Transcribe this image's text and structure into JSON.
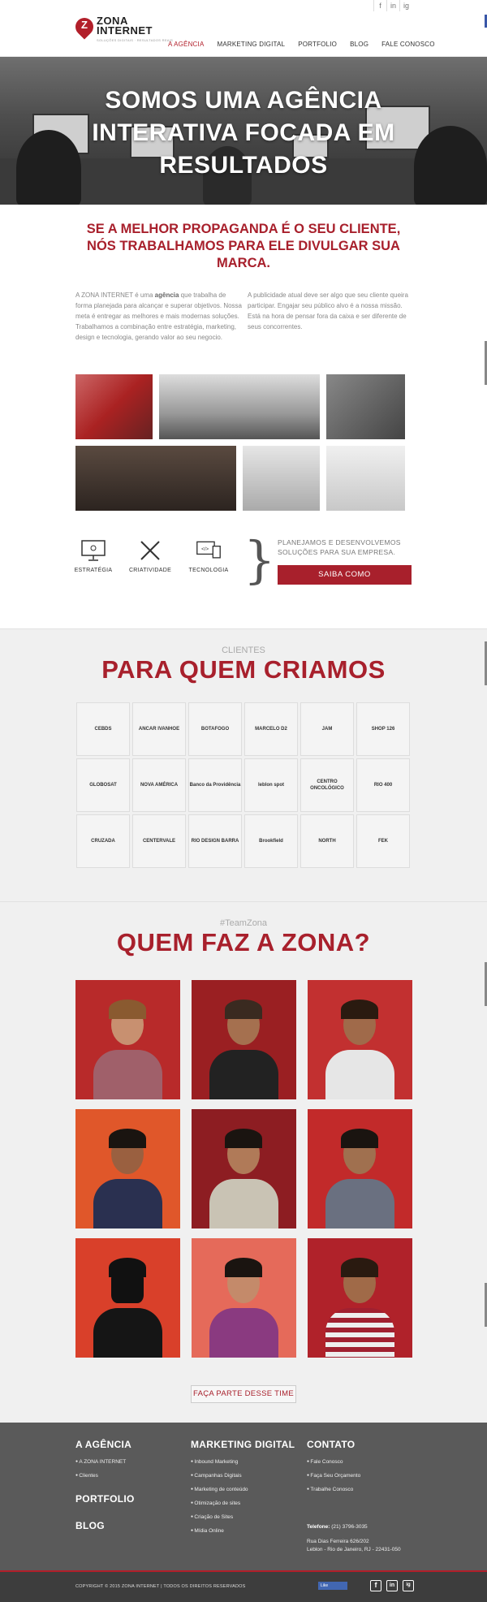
{
  "topbar": {
    "social": [
      "f",
      "in",
      "ig"
    ]
  },
  "header": {
    "logo_title": "ZONA INTERNET",
    "logo_tagline": "SOLUÇÕES DIGITAIS · RESULTADOS REAIS",
    "nav": [
      {
        "label": "A AGÊNCIA",
        "active": true
      },
      {
        "label": "MARKETING DIGITAL",
        "active": false
      },
      {
        "label": "PORTFOLIO",
        "active": false
      },
      {
        "label": "BLOG",
        "active": false
      },
      {
        "label": "FALE CONOSCO",
        "active": false
      }
    ]
  },
  "hero": {
    "line1": "SOMOS UMA AGÊNCIA",
    "line2": "INTERATIVA FOCADA EM",
    "line3": "RESULTADOS"
  },
  "intro": {
    "head1": "SE A MELHOR PROPAGANDA É O SEU CLIENTE,",
    "head2": "NÓS TRABALHAMOS PARA ELE DIVULGAR SUA",
    "head3": "MARCA.",
    "left_text_a": "A ZONA INTERNET é uma ",
    "left_bold": "agência",
    "left_text_b": " que trabalha de forma planejada para alcançar e superar objetivos. Nossa meta é entregar as melhores e mais modernas soluções. Trabalhamos a combinação entre estratégia, marketing, design e tecnologia, gerando valor ao seu negocio.",
    "right_text": "A publicidade atual deve ser algo que seu cliente queira participar. Engajar seu público alvo é a nossa missão. Está na hora de pensar fora da caixa e ser diferente de seus concorrentes."
  },
  "services": {
    "items": [
      {
        "label": "ESTRATÉGIA",
        "icon": "monitor-strategy-icon"
      },
      {
        "label": "CRIATIVIDADE",
        "icon": "pencil-brush-icon"
      },
      {
        "label": "TECNOLOGIA",
        "icon": "devices-code-icon"
      }
    ],
    "text1": "PLANEJAMOS E DESENVOLVEMOS",
    "text2": "SOLUÇÕES PARA SUA EMPRESA.",
    "button": "SAIBA COMO"
  },
  "clients": {
    "sub": "CLIENTES",
    "title": "PARA QUEM CRIAMOS",
    "logos": [
      "CEBDS",
      "ANCAR IVANHOE",
      "BOTAFOGO",
      "MARCELO D2",
      "JAM",
      "SHOP 126",
      "GLOBOSAT",
      "NOVA AMÉRICA",
      "Banco da Providência",
      "leblon spot",
      "CENTRO ONCOLÓGICO",
      "RIO 400",
      "CRUZADA",
      "CENTERVALE",
      "RIO DESIGN BARRA",
      "Brookfield",
      "NORTH",
      "FEK"
    ]
  },
  "team": {
    "sub": "#TeamZona",
    "title": "QUEM FAZ A ZONA?",
    "button": "FAÇA PARTE DESSE TIME"
  },
  "footer": {
    "col1_title": "A AGÊNCIA",
    "col1_items": [
      "A ZONA INTERNET",
      "Clientes"
    ],
    "col1_title2": "PORTFOLIO",
    "col1_title3": "BLOG",
    "col2_title": "MARKETING DIGITAL",
    "col2_items": [
      "Inbound Marketing",
      "Campanhas Digitais",
      "Marketing de conteúdo",
      "Otimização de sites",
      "Criação de Sites",
      "Mídia Online"
    ],
    "col3_title": "CONTATO",
    "col3_items": [
      "Fale Conosco",
      "Faça Seu Orçamento",
      "Trabalhe Conosco"
    ],
    "phone_label": "Telefone:",
    "phone": " (21) 3796-3035",
    "address1": "Rua Dias Ferreira 626/202",
    "address2": "Leblon - Rio de Janeiro, RJ - 22431-050",
    "copyright": "COPYRIGHT © 2015 ZONA INTERNET | TODOS OS DIREITOS RESERVADOS",
    "fb_like": "Like",
    "social": [
      "f",
      "in",
      "ig"
    ]
  },
  "colors": {
    "brand_red": "#a8202c",
    "footer_bg": "#5a5a5a"
  }
}
